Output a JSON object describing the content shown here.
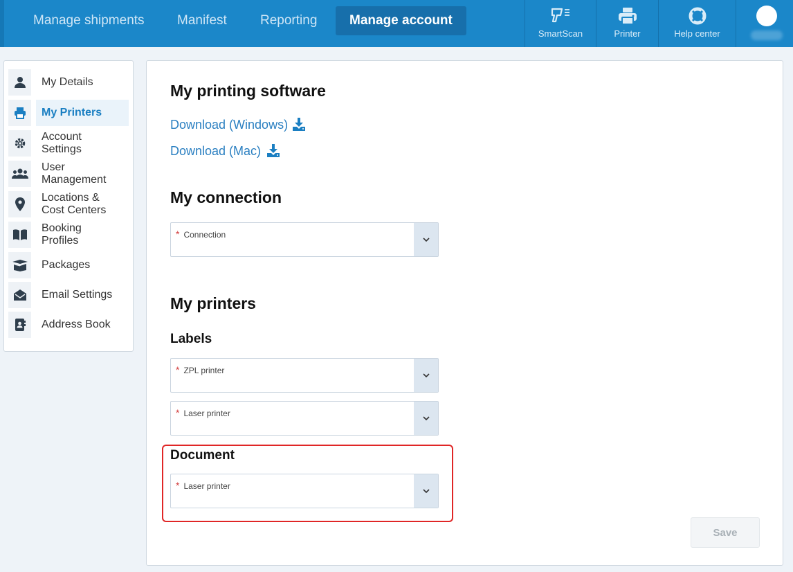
{
  "nav": {
    "tabs": [
      "Manage shipments",
      "Manifest",
      "Reporting",
      "Manage account"
    ],
    "active": "Manage account",
    "tools": [
      {
        "label": "SmartScan",
        "icon": "scanner-icon"
      },
      {
        "label": "Printer",
        "icon": "printer-icon"
      },
      {
        "label": "Help center",
        "icon": "lifebuoy-icon"
      }
    ]
  },
  "sidebar": {
    "items": [
      {
        "label": "My Details",
        "icon": "user-icon"
      },
      {
        "label": "My Printers",
        "icon": "printer-icon",
        "active": true
      },
      {
        "label": "Account\nSettings",
        "icon": "gear-icon"
      },
      {
        "label": "User\nManagement",
        "icon": "users-icon"
      },
      {
        "label": "Locations &\nCost Centers",
        "icon": "location-pin-icon"
      },
      {
        "label": "Booking\nProfiles",
        "icon": "book-icon"
      },
      {
        "label": "Packages",
        "icon": "package-icon"
      },
      {
        "label": "Email Settings",
        "icon": "envelope-icon"
      },
      {
        "label": "Address Book",
        "icon": "address-book-icon"
      }
    ]
  },
  "main": {
    "software_title": "My printing software",
    "download_windows": "Download (Windows)",
    "download_mac": "Download (Mac)",
    "connection_title": "My connection",
    "connection_field": "Connection",
    "printers_title": "My printers",
    "labels_title": "Labels",
    "zpl_field": "ZPL printer",
    "laser_field": "Laser printer",
    "document_title": "Document",
    "document_field": "Laser printer",
    "required_mark": "*",
    "save_label": "Save"
  },
  "colors": {
    "brand": "#1b87c9",
    "link": "#2a7fc1",
    "highlight": "#e02626"
  }
}
